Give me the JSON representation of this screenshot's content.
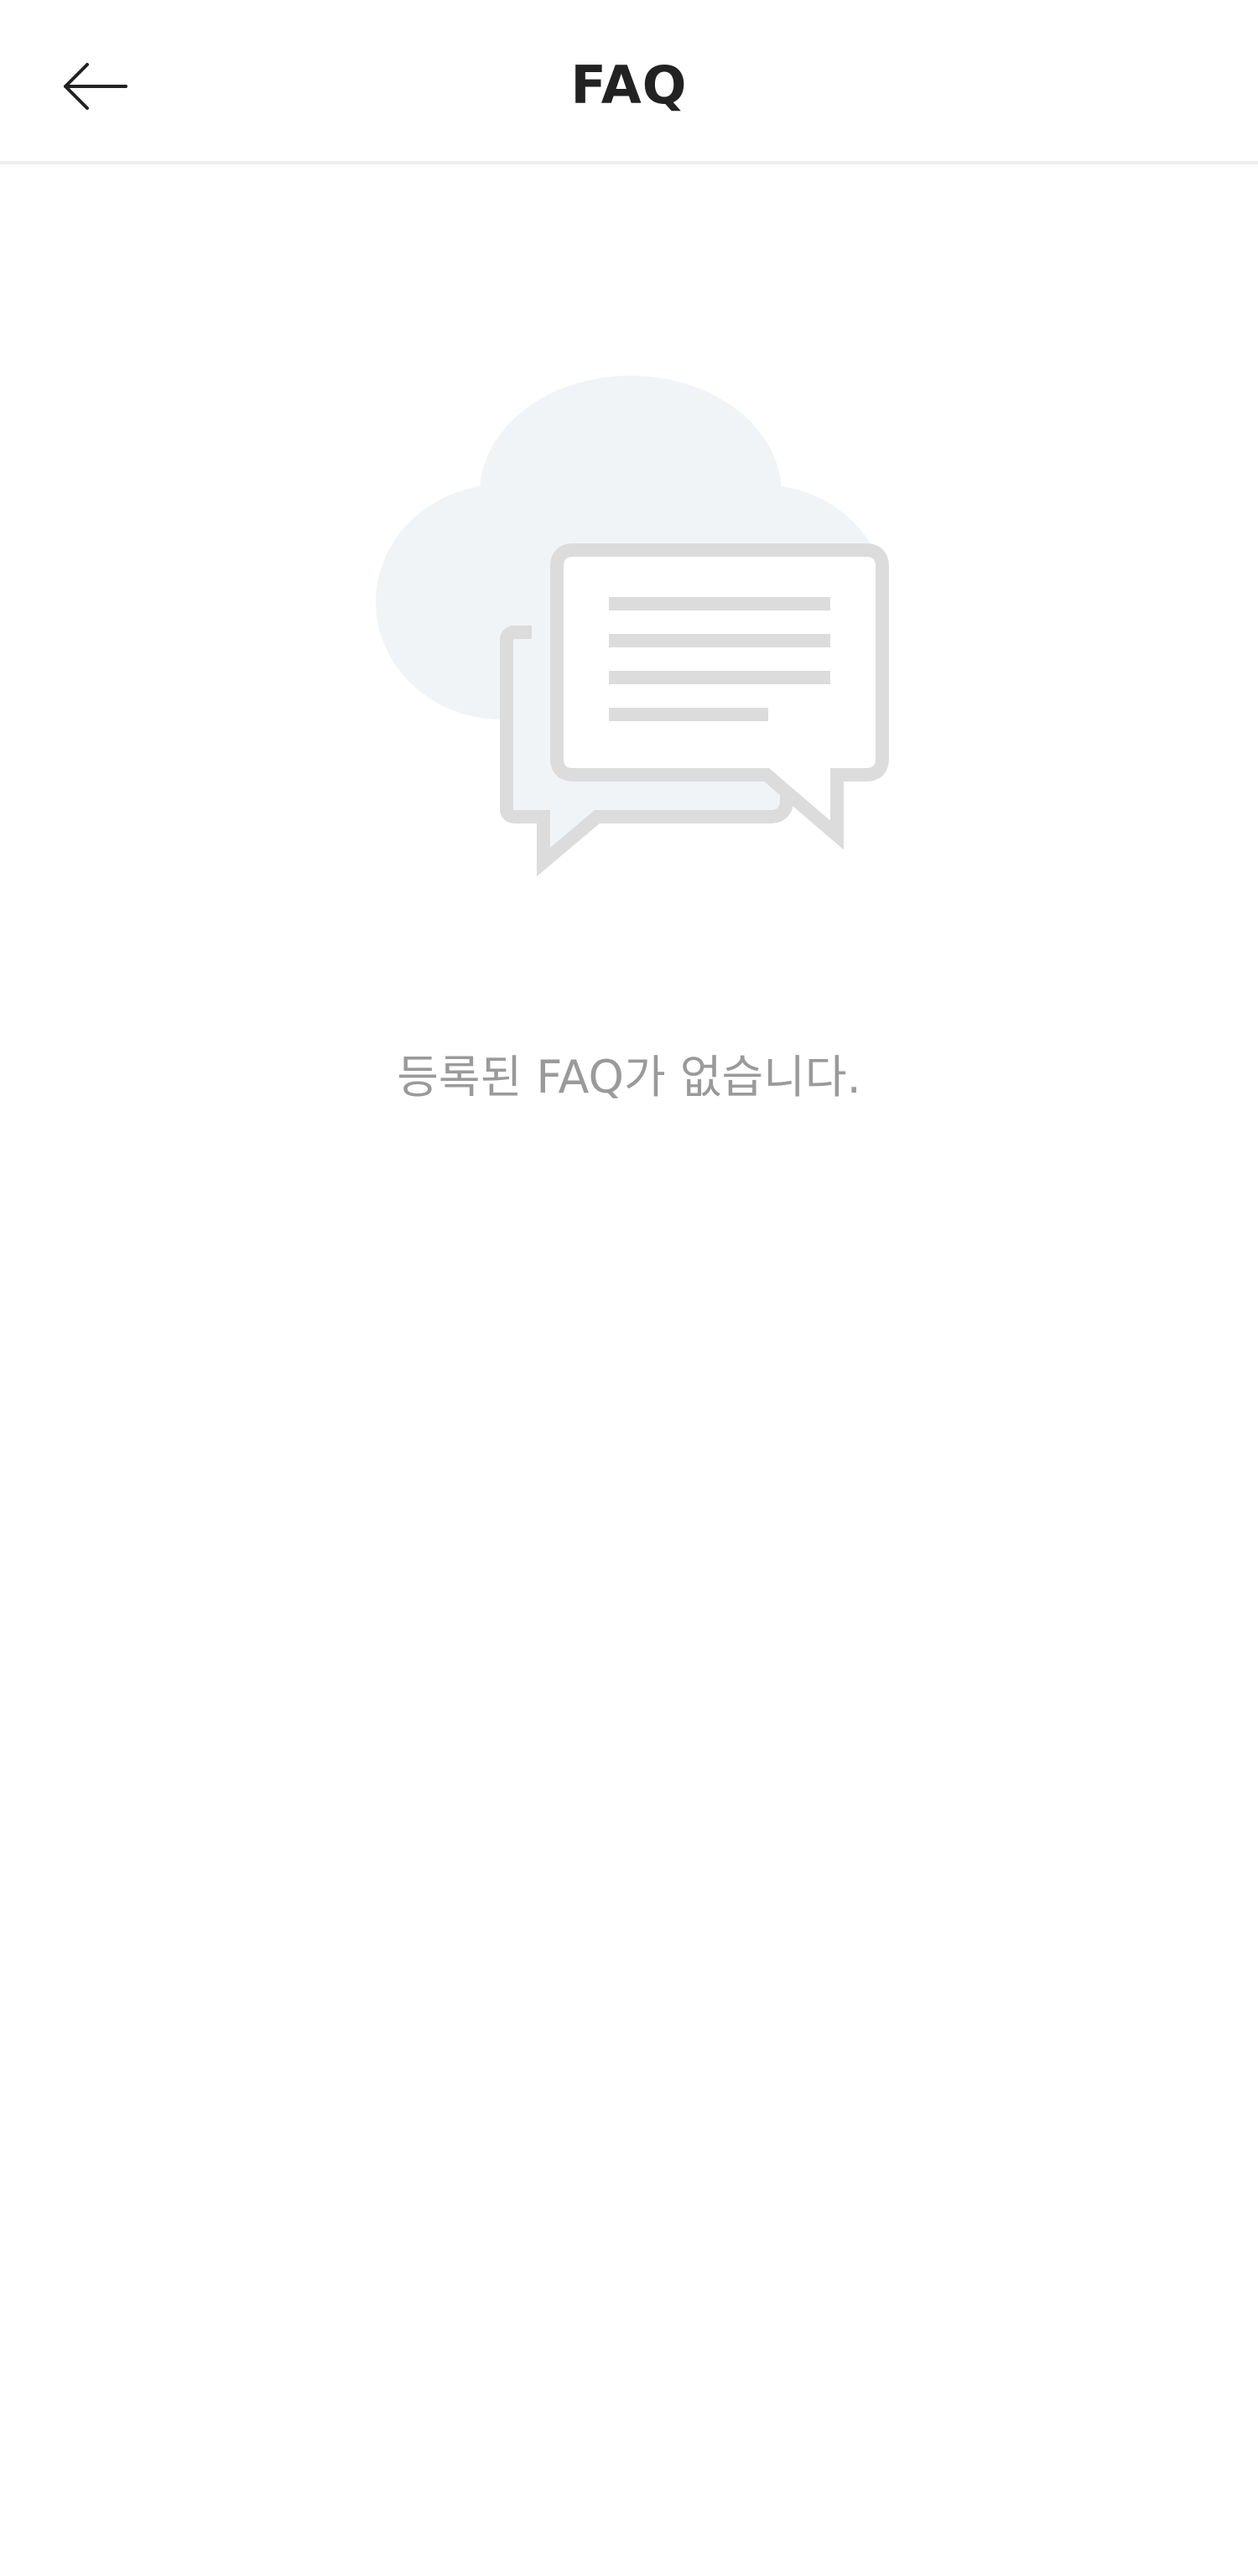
{
  "header": {
    "title": "FAQ",
    "back_icon": "arrow-left-icon"
  },
  "empty_state": {
    "illustration_icon": "chat-bubbles-icon",
    "message": "등록된 FAQ가 없습니다."
  },
  "colors": {
    "background": "#ffffff",
    "title_text": "#222222",
    "message_text": "#9a9a9a",
    "cloud": "#f1f4f7",
    "bubble_stroke": "#dcdcdc",
    "divider": "#eeeeee"
  }
}
